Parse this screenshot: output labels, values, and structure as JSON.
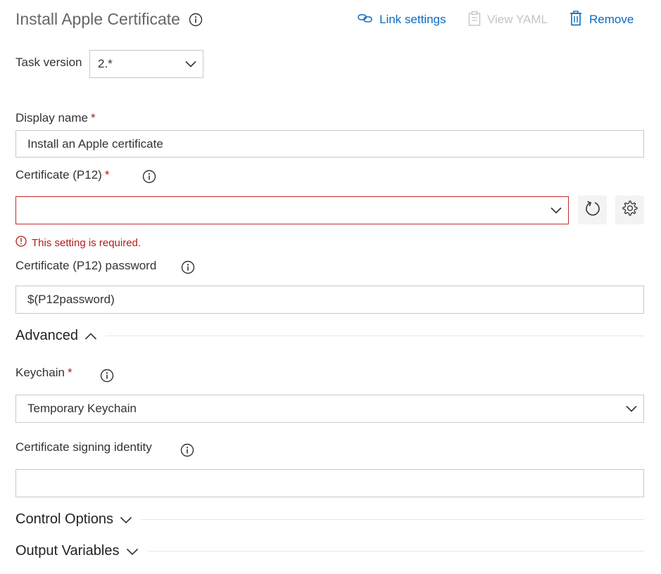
{
  "header": {
    "title": "Install Apple Certificate",
    "link_settings_label": "Link settings",
    "view_yaml_label": "View YAML",
    "remove_label": "Remove"
  },
  "task_version": {
    "label": "Task version",
    "value": "2.*"
  },
  "display_name": {
    "label": "Display name",
    "required_mark": "*",
    "value": "Install an Apple certificate"
  },
  "certificate": {
    "label": "Certificate (P12)",
    "required_mark": "*",
    "value": "",
    "error_message": "This setting is required."
  },
  "certificate_password": {
    "label": "Certificate (P12) password",
    "value": "$(P12password)"
  },
  "advanced": {
    "title": "Advanced",
    "expanded": true
  },
  "keychain": {
    "label": "Keychain",
    "required_mark": "*",
    "value": "Temporary Keychain"
  },
  "signing_identity": {
    "label": "Certificate signing identity",
    "value": ""
  },
  "control_options": {
    "title": "Control Options",
    "expanded": false
  },
  "output_variables": {
    "title": "Output Variables",
    "expanded": false
  },
  "colors": {
    "accent": "#0b6cc2",
    "error": "#b31b1b",
    "disabled": "#c4c4c4",
    "border": "#c8c8c8"
  },
  "icons": {
    "info": "info-icon",
    "link": "link-icon",
    "yaml": "clipboard-icon",
    "remove": "trash-icon",
    "refresh": "refresh-icon",
    "manage": "gear-icon",
    "error": "error-icon",
    "chevron_down": "chevron-down-icon",
    "chevron_up": "chevron-up-icon"
  }
}
